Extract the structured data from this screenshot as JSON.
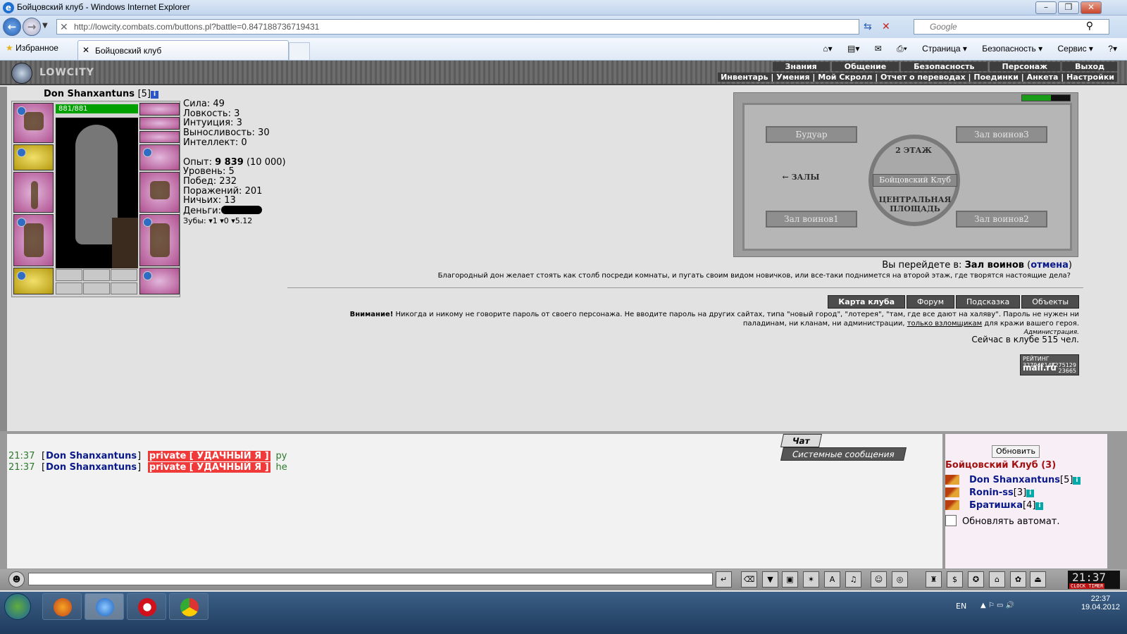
{
  "window": {
    "title": "Бойцовский клуб - Windows Internet Explorer"
  },
  "browser": {
    "url": "http://lowcity.combats.com/buttons.pl?battle=0.847188736719431",
    "search_placeholder": "Google",
    "favorites": "Избранное",
    "tab": "Бойцовский клуб",
    "commands": [
      "Страница ▾",
      "Безопасность ▾",
      "Сервис ▾"
    ]
  },
  "game": {
    "logo": "LOWCITY",
    "menu_top": [
      "Знания",
      "Общение",
      "Безопасность",
      "Персонаж",
      "Выход"
    ],
    "menu_sub": "Инвентарь | Умения | Мой Скролл | Отчет о переводах | Поединки | Анкета | Настройки",
    "character": {
      "name": "Don Shanxantuns",
      "level": "[5]",
      "hp": "881/881",
      "hp_fraction": 1.0
    },
    "stats": {
      "sila": "Сила: 49",
      "lovkost": "Ловкость: 3",
      "intuicia": "Интуиция: 3",
      "vynoslivost": "Выносливость: 30",
      "intellekt": "Интеллект: 0",
      "opyt_label": "Опыт: ",
      "opyt_value": "9 839",
      "opyt_next": " (10 000)",
      "uroven": "Уровень: 5",
      "pobed": "Побед: 232",
      "porazheniy": "Поражений: 201",
      "nichyih": "Ничьих: 13",
      "dengi": "Деньги:",
      "zuby": "Зубы: ▾1 ▾0 ▾5.12"
    },
    "map": {
      "rooms": [
        "Будуар",
        "Зал воинов3",
        "Зал воинов1",
        "Зал воинов2"
      ],
      "floor": "2 ЭТАЖ",
      "halls": "← ЗАЛЫ",
      "club": "Бойцовский Клуб",
      "square": "ЦЕНТРАЛЬНАЯ ПЛОЩАДЬ"
    },
    "goto": {
      "prefix": "Вы перейдете в: ",
      "target": "Зал воинов",
      "cancel": "отмена"
    },
    "description": "Благородный дон желает стоять как столб посреди комнаты, и пугать своим видом новичков, или все-таки поднимется на второй этаж, где творятся настоящие дела?",
    "buttons": [
      "Карта клуба",
      "Форум",
      "Подсказка",
      "Объекты"
    ],
    "warning": {
      "bold": "Внимание!",
      "text1": " Никогда и никому не говорите пароль от своего персонажа. Не вводите пароль на других сайтах, типа \"новый город\", \"лотерея\", \"там, где все дают на халяву\". Пароль не нужен ни паладинам, ни кланам, ни администрации, ",
      "link": "только взломщикам",
      "text2": " для кражи вашего героя.",
      "sign": "Администрация."
    },
    "online": "Сейчас в клубе 515 чел.",
    "rating": {
      "label": "РЕЙТИНГ",
      "id": "32794214K",
      "brand": "mail.ru",
      "n1": "7275129",
      "n2": "23665"
    }
  },
  "chat": {
    "tabs": [
      "Чат",
      "Системные сообщения"
    ],
    "messages": [
      {
        "time": "21:37",
        "name": "Don Shanxantuns",
        "private": "private [ УДАЧНЫЙ Я ]",
        "text": "ру"
      },
      {
        "time": "21:37",
        "name": "Don Shanxantuns",
        "private": "private [ УДАЧНЫЙ Я ]",
        "text": "he"
      }
    ]
  },
  "room": {
    "refresh": "Обновить",
    "name": "Бойцовский Клуб (3)",
    "users": [
      {
        "name": "Don Shanxantuns",
        "level": "[5]"
      },
      {
        "name": "Ronin-ss",
        "level": "[3]"
      },
      {
        "name": "Братишка",
        "level": "[4]"
      }
    ],
    "auto": "Обновлять автомат."
  },
  "clock": {
    "time": "21:37",
    "label": "CLOCK TIMER"
  },
  "taskbar": {
    "lang": "EN",
    "time": "22:37",
    "date": "19.04.2012"
  }
}
